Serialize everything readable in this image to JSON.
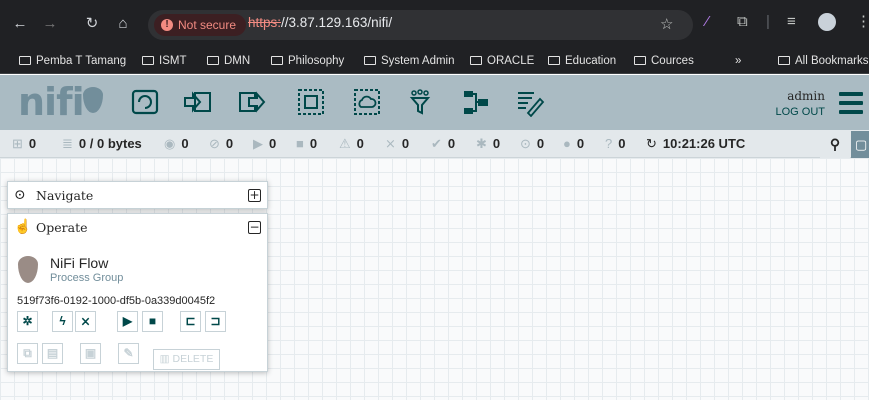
{
  "browser": {
    "not_secure_label": "Not secure",
    "url_scheme": "https:",
    "url_rest": "//3.87.129.163/nifi/",
    "bookmarks": [
      "Pemba T Tamang",
      "ISMT",
      "DMN",
      "Philosophy",
      "System Admin",
      "ORACLE",
      "Education",
      "Cources"
    ],
    "all_bookmarks": "All Bookmarks",
    "overflow": "»"
  },
  "header": {
    "logo": "nifi",
    "user": "admin",
    "logout": "LOG OUT"
  },
  "status": {
    "active_threads": "0",
    "queued": "0 / 0 bytes",
    "transmitting": "0",
    "not_transmitting": "0",
    "running": "0",
    "stopped": "0",
    "invalid": "0",
    "disabled": "0",
    "up_to_date": "0",
    "locally_modified": "0",
    "stale": "0",
    "locally_modified_stale": "0",
    "sync_failure": "0",
    "time": "10:21:26 UTC"
  },
  "navigate": {
    "title": "Navigate",
    "toggle": "+"
  },
  "operate": {
    "title": "Operate",
    "toggle": "−",
    "name": "NiFi Flow",
    "type": "Process Group",
    "id": "519f73f6-0192-1000-df5b-0a339d0045f2",
    "delete_label": "DELETE"
  },
  "colors": {
    "header": "#aabbc3",
    "accent": "#004849",
    "logo": "#728e9b"
  }
}
